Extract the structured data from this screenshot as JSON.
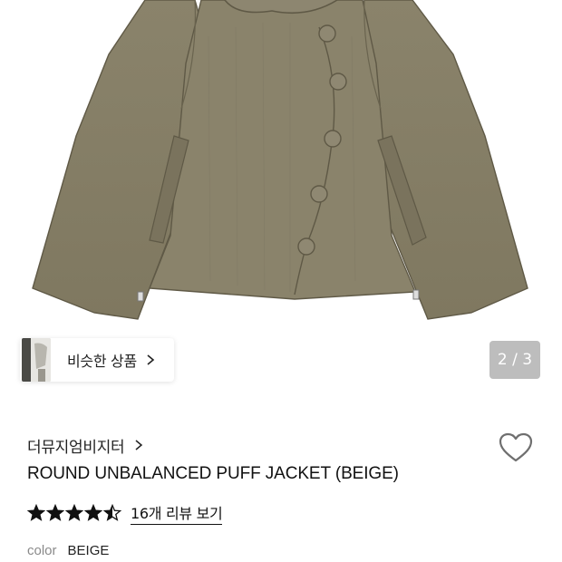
{
  "product_image": {
    "description_icon": "jacket-image",
    "jacket_color": "#857d65",
    "current_page": "2 / 3"
  },
  "similar": {
    "label": "비슷한 상품",
    "icon": "chevron-right-icon"
  },
  "brand": {
    "name": "더뮤지엄비지터",
    "icon": "chevron-right-icon"
  },
  "wishlist": {
    "icon": "heart-outline-icon"
  },
  "product": {
    "title": "ROUND UNBALANCED PUFF JACKET (BEIGE)"
  },
  "rating": {
    "score": 4.5,
    "max": 5,
    "review_link": "16개 리뷰 보기"
  },
  "color": {
    "label": "color",
    "value": "BEIGE"
  },
  "colors": {
    "text": "#111111",
    "muted": "#8a8a8a",
    "counter_bg": "#bdbdbd"
  }
}
